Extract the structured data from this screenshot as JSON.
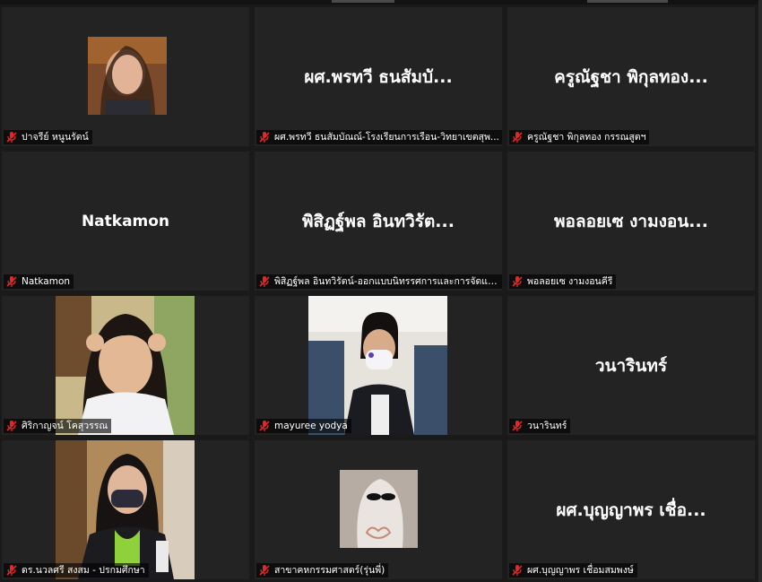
{
  "colors": {
    "background": "#1a1a1a",
    "tile": "#232323",
    "muted_mic": "#e02828"
  },
  "tiles": [
    {
      "label": "ปาจรีย์ หนูนรัตน์",
      "big": "",
      "has_video": true
    },
    {
      "label": "ผศ.พรทวี ธนสัมบัณณ์-โรงเรียนการเรือน-วิทยาเขตสุพ...",
      "big": "ผศ.พรทวี ธนสัมบั...",
      "has_video": false
    },
    {
      "label": "ครูณัฐชา พิกุลทอง กรรณสูตฯ",
      "big": "ครูณัฐชา พิกุลทอง...",
      "has_video": false
    },
    {
      "label": "Natkamon",
      "big": "Natkamon",
      "has_video": false
    },
    {
      "label": "พิสิฏฐ์พล อินทวิรัตน์-ออกแบบนิทรรศการและการจัดแสดง",
      "big": "พิสิฏฐ์พล อินทวิรัต...",
      "has_video": false
    },
    {
      "label": "พอลอยเซ งามงอนคีรี",
      "big": "พอลอยเซ งามงอน...",
      "has_video": false
    },
    {
      "label": "ศิริกาญจน์ โคสุวรรณ",
      "big": "",
      "has_video": true
    },
    {
      "label": "mayuree yodya",
      "big": "",
      "has_video": true
    },
    {
      "label": "วนารินทร์",
      "big": "วนารินทร์",
      "has_video": false
    },
    {
      "label": "ดร.นวลศรี สงสม - ปรกมศึกษา",
      "big": "",
      "has_video": true
    },
    {
      "label": "สาขาคหกรรมศาสตร์(รุ่นพี่)",
      "big": "",
      "has_video": true
    },
    {
      "label": "ผศ.บุญญาพร เชื่อมสมพงษ์",
      "big": "ผศ.บุญญาพร เชื่อ...",
      "has_video": false
    }
  ]
}
